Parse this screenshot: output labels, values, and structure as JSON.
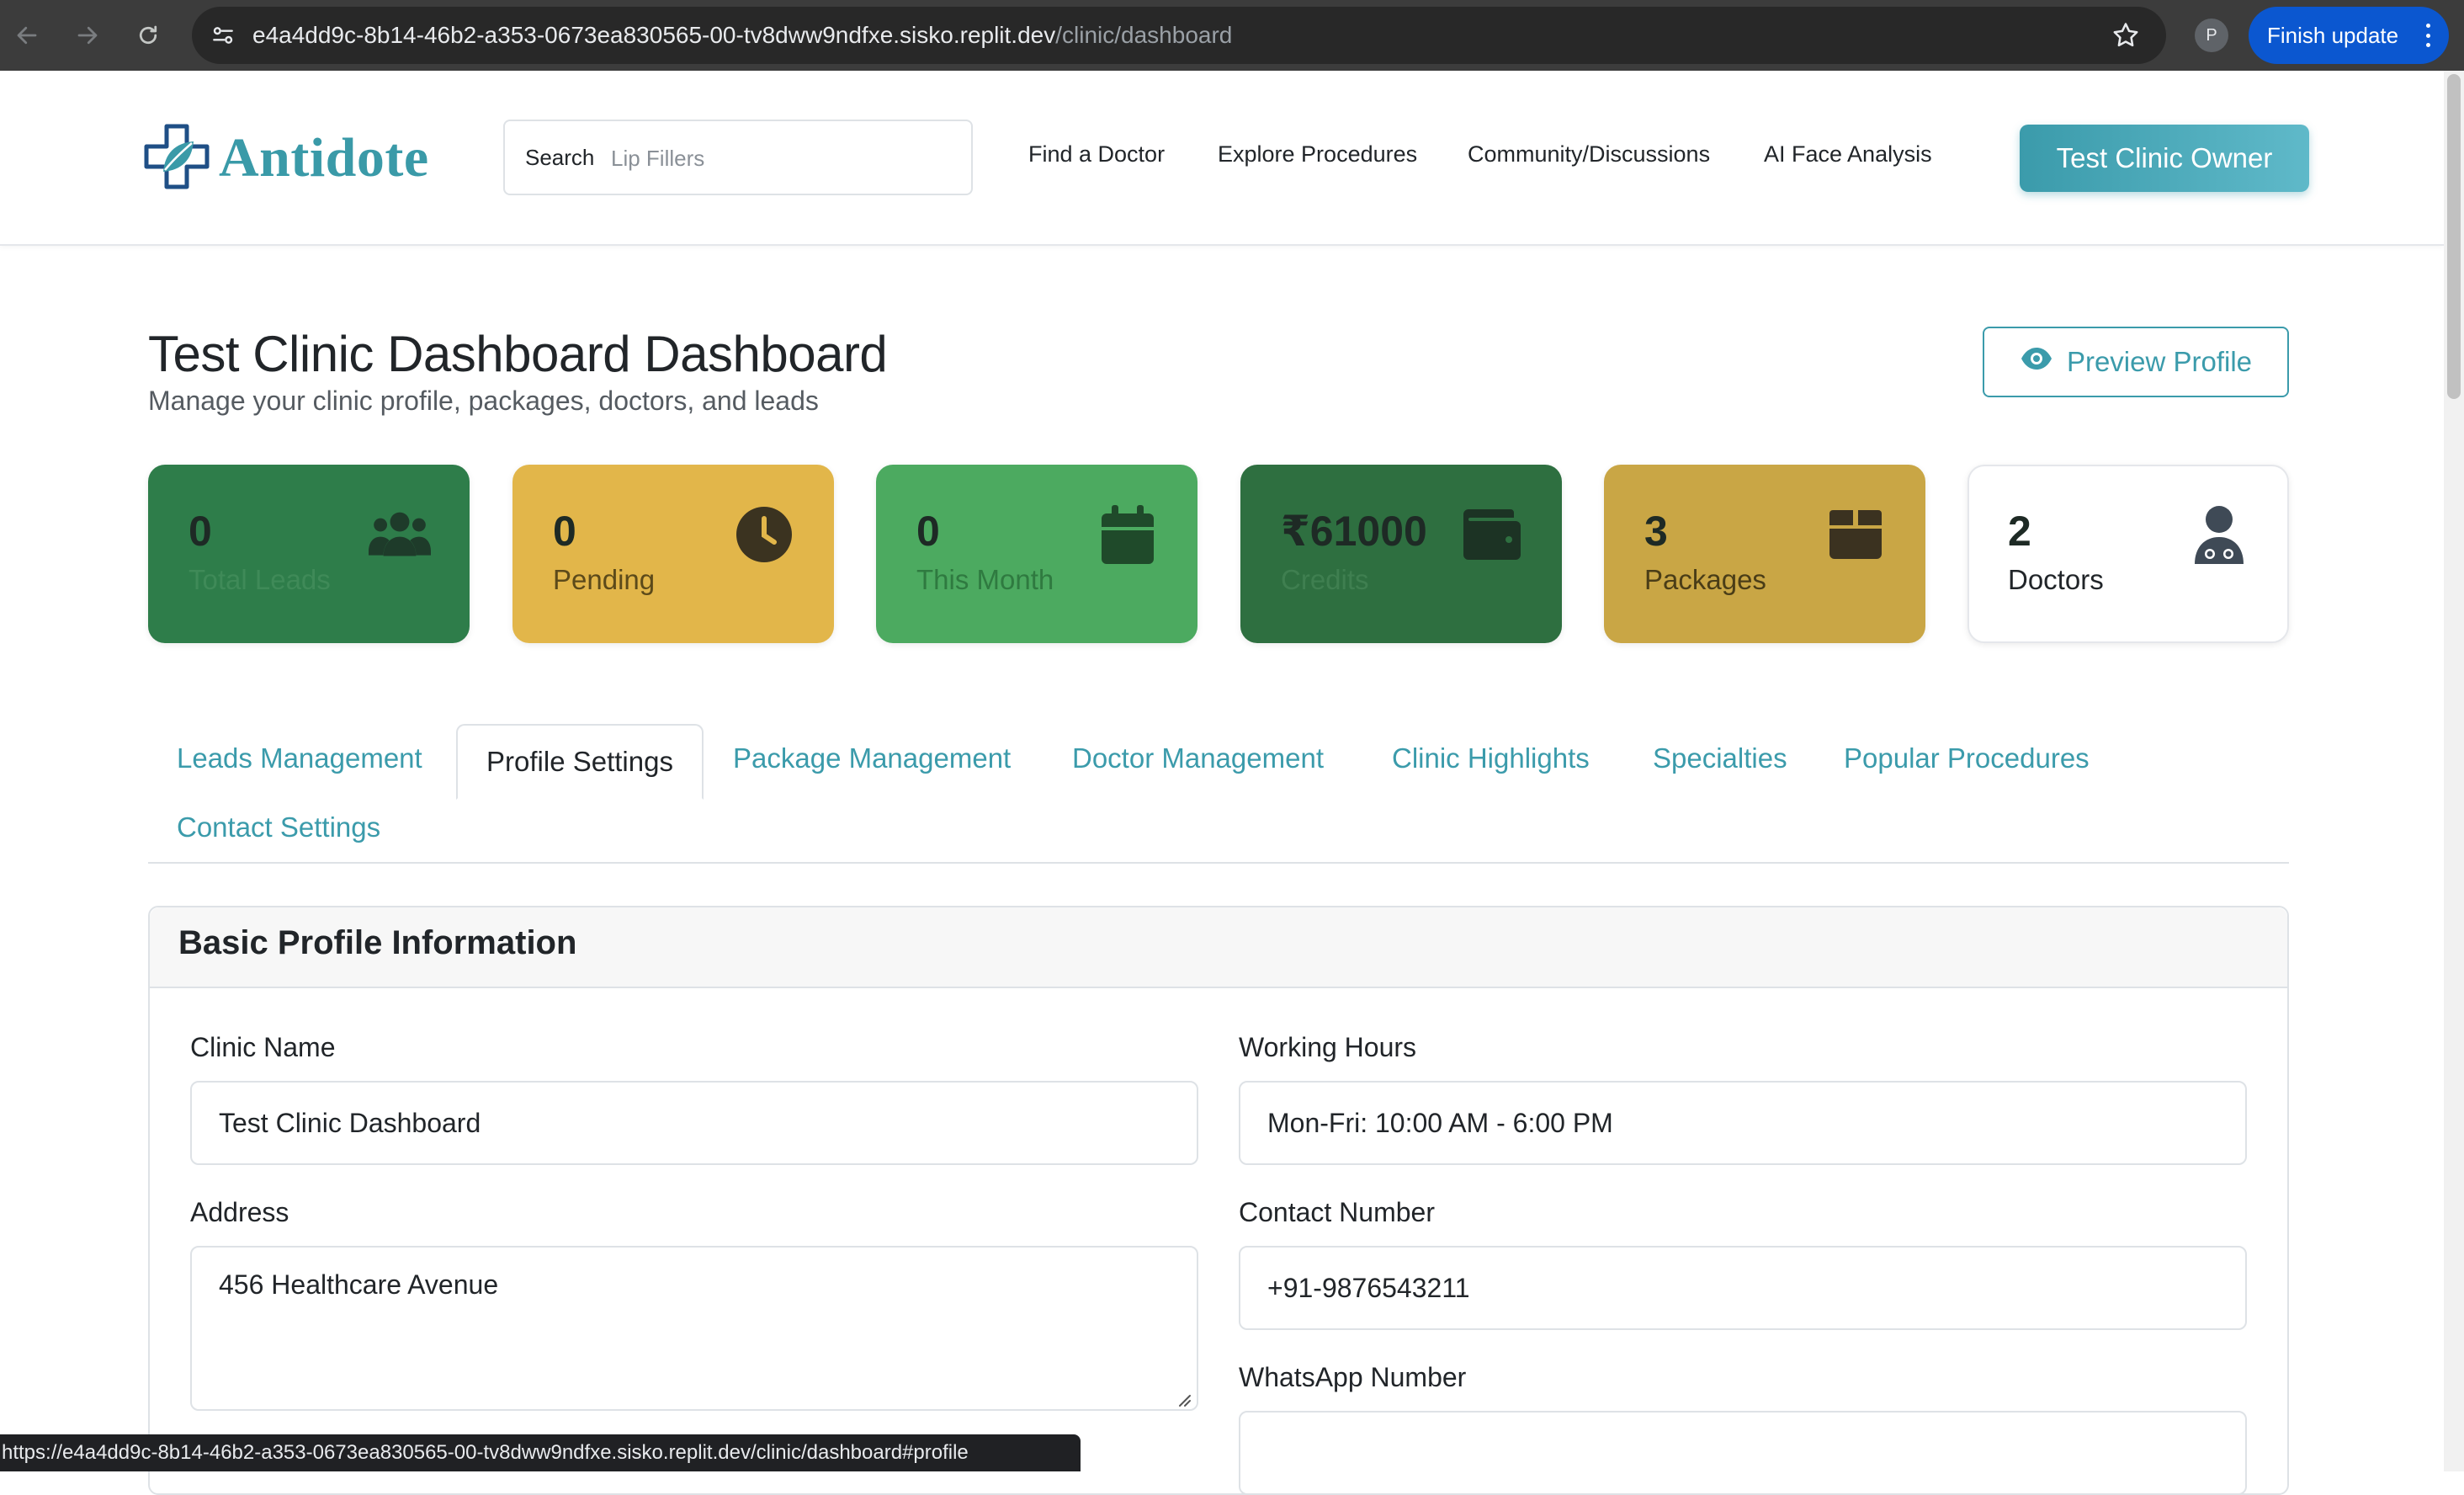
{
  "browser": {
    "url_host": "e4a4dd9c-8b14-46b2-a353-0673ea830565-00-tv8dww9ndfxe.sisko.replit.dev",
    "url_path": "/clinic/dashboard",
    "profile_initial": "P",
    "finish_update_label": "Finish update",
    "status_url": "https://e4a4dd9c-8b14-46b2-a353-0673ea830565-00-tv8dww9ndfxe.sisko.replit.dev/clinic/dashboard#profile"
  },
  "header": {
    "logo_text": "Antidote",
    "search_label": "Search",
    "search_placeholder": "Lip Fillers",
    "nav": [
      "Find a Doctor",
      "Explore Procedures",
      "Community/Discussions",
      "AI Face Analysis"
    ],
    "user_button": "Test Clinic Owner",
    "brand_color": "#3b9bab"
  },
  "page": {
    "title": "Test Clinic Dashboard Dashboard",
    "subtitle": "Manage your clinic profile, packages, doctors, and leads",
    "preview_button": "Preview Profile"
  },
  "stats": [
    {
      "value": "0",
      "label": "Total Leads",
      "icon": "users-icon",
      "bg": "#2e7d4a"
    },
    {
      "value": "0",
      "label": "Pending",
      "icon": "clock-icon",
      "bg": "#e2b64a"
    },
    {
      "value": "0",
      "label": "This Month",
      "icon": "calendar-icon",
      "bg": "#4caa60"
    },
    {
      "value": "₹61000",
      "label": "Credits",
      "icon": "wallet-icon",
      "bg": "#2e6f40"
    },
    {
      "value": "3",
      "label": "Packages",
      "icon": "box-icon",
      "bg": "#c9a645"
    },
    {
      "value": "2",
      "label": "Doctors",
      "icon": "doctor-icon",
      "bg": "#ffffff"
    }
  ],
  "tabs": [
    "Leads Management",
    "Profile Settings",
    "Package Management",
    "Doctor Management",
    "Clinic Highlights",
    "Specialties",
    "Popular Procedures",
    "Contact Settings"
  ],
  "active_tab": "Profile Settings",
  "profile_form": {
    "section_title": "Basic Profile Information",
    "clinic_name_label": "Clinic Name",
    "clinic_name_value": "Test Clinic Dashboard",
    "working_hours_label": "Working Hours",
    "working_hours_value": "Mon-Fri: 10:00 AM - 6:00 PM",
    "address_label": "Address",
    "address_value": "456 Healthcare Avenue",
    "contact_label": "Contact Number",
    "contact_value": "+91-9876543211",
    "whatsapp_label": "WhatsApp Number",
    "whatsapp_value": ""
  }
}
